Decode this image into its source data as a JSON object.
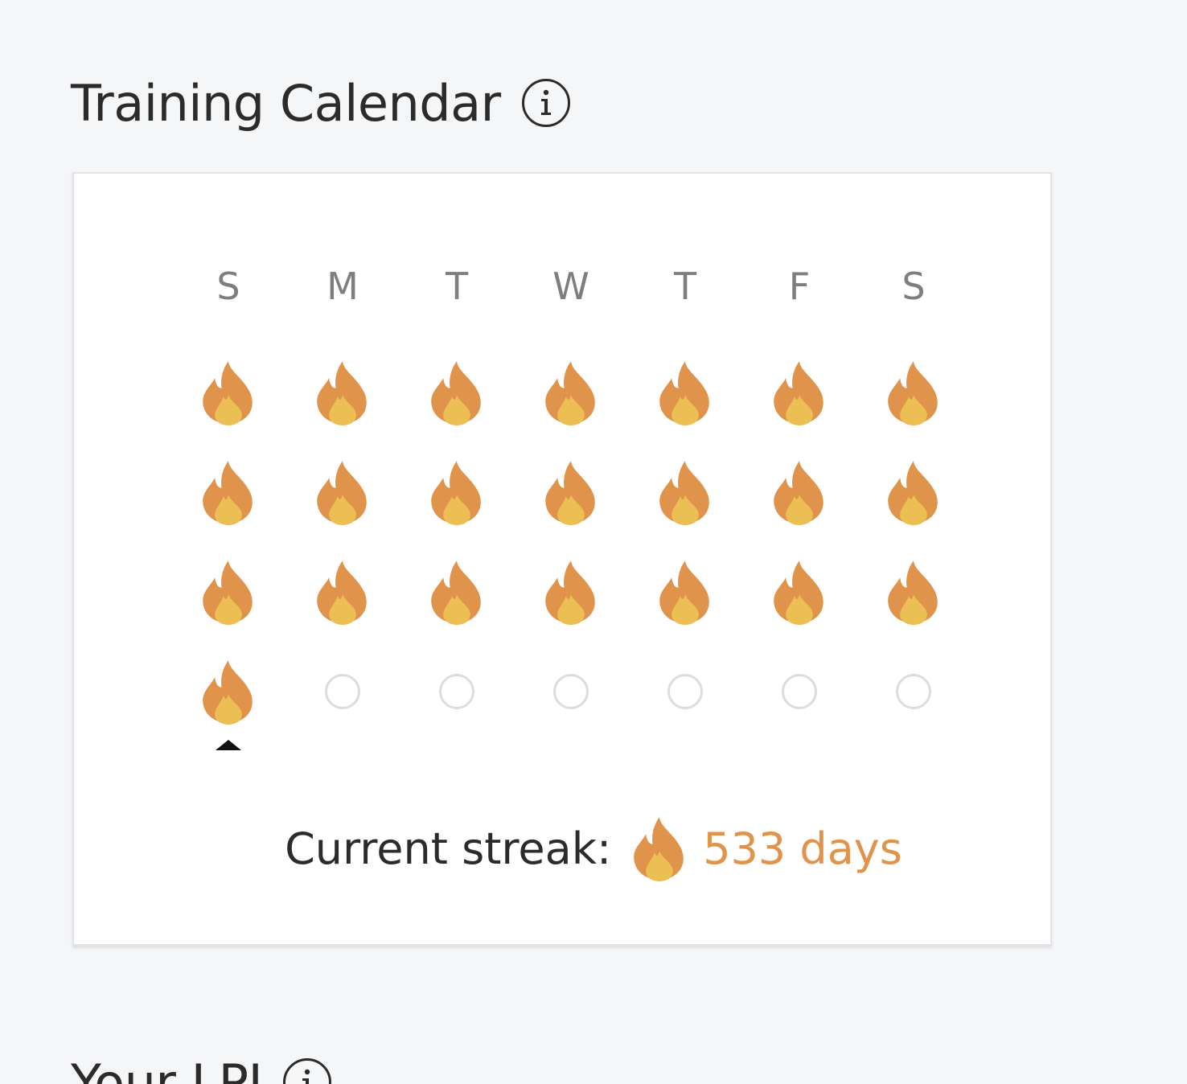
{
  "training_calendar": {
    "title": "Training Calendar",
    "info_icon": "info-circle-icon",
    "day_headers": [
      "S",
      "M",
      "T",
      "W",
      "T",
      "F",
      "S"
    ],
    "weeks": [
      [
        "flame",
        "flame",
        "flame",
        "flame",
        "flame",
        "flame",
        "flame"
      ],
      [
        "flame",
        "flame",
        "flame",
        "flame",
        "flame",
        "flame",
        "flame"
      ],
      [
        "flame",
        "flame",
        "flame",
        "flame",
        "flame",
        "flame",
        "flame"
      ],
      [
        "flame",
        "empty",
        "empty",
        "empty",
        "empty",
        "empty",
        "empty"
      ]
    ],
    "today_marker_icon": "caret-up-icon",
    "streak": {
      "label": "Current streak:",
      "icon": "flame-icon",
      "value": "533 days"
    }
  },
  "next_section": {
    "title": "Your LPI",
    "info_icon": "info-circle-icon"
  },
  "colors": {
    "background": "#f5f6f8",
    "card": "#ffffff",
    "flame_outer": "#e0934a",
    "flame_inner": "#ecbf55",
    "streak_value": "#e0934a",
    "empty_circle": "#dddddd",
    "header_text": "#7e7e7e",
    "title_text": "#2b2b2b"
  }
}
